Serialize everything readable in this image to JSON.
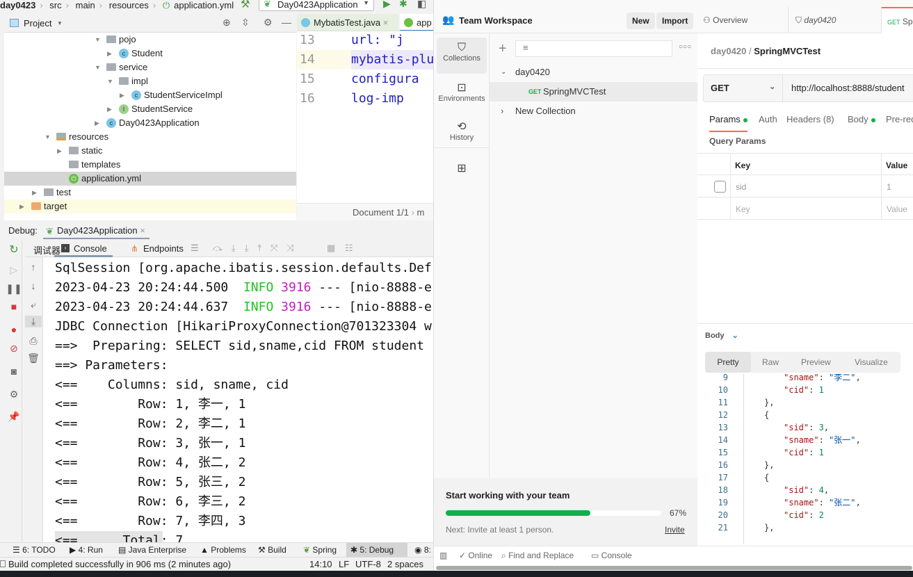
{
  "ide": {
    "breadcrumb": [
      "day0423",
      "src",
      "main",
      "resources",
      "application.yml"
    ],
    "run_config": "Day0423Application",
    "project_panel": {
      "title": "Project"
    },
    "tree": [
      {
        "label": "pojo",
        "type": "package",
        "expanded": true
      },
      {
        "label": "Student",
        "type": "class"
      },
      {
        "label": "service",
        "type": "package",
        "expanded": true
      },
      {
        "label": "impl",
        "type": "package",
        "expanded": true
      },
      {
        "label": "StudentServiceImpl",
        "type": "class"
      },
      {
        "label": "StudentService",
        "type": "interface"
      },
      {
        "label": "Day0423Application",
        "type": "spring-app"
      },
      {
        "label": "resources",
        "type": "resource-folder",
        "expanded": true
      },
      {
        "label": "static",
        "type": "folder"
      },
      {
        "label": "templates",
        "type": "folder"
      },
      {
        "label": "application.yml",
        "type": "yml",
        "selected": true
      },
      {
        "label": "test",
        "type": "folder"
      },
      {
        "label": "target",
        "type": "excluded-folder"
      }
    ],
    "editor": {
      "tabs": [
        {
          "label": "MybatisTest.java"
        },
        {
          "label": "app",
          "active": true
        }
      ],
      "lines": [
        {
          "num": "13",
          "code": "  url: \"j"
        },
        {
          "num": "14",
          "code": "mybatis-plu"
        },
        {
          "num": "15",
          "code": " configura"
        },
        {
          "num": "16",
          "code": "  log-imp"
        }
      ],
      "breadcrumb": "Document 1/1",
      "breadcrumb_next": "m"
    },
    "debug": {
      "label": "Debug:",
      "session_tab": "Day0423Application",
      "tabs": [
        "调试器",
        "Console",
        "Endpoints"
      ],
      "active_tab": "Console",
      "console_lines": [
        [
          {
            "t": "SqlSession [org.apache.ibatis.session.defaults.Def"
          }
        ],
        [
          {
            "t": "2023-04-23 20:24:44.500  "
          },
          {
            "t": "INFO",
            "c": "#22c322"
          },
          {
            "t": " "
          },
          {
            "t": "3916",
            "c": "#c21ec2"
          },
          {
            "t": " --- [nio-8888-e"
          }
        ],
        [
          {
            "t": "2023-04-23 20:24:44.637  "
          },
          {
            "t": "INFO",
            "c": "#22c322"
          },
          {
            "t": " "
          },
          {
            "t": "3916",
            "c": "#c21ec2"
          },
          {
            "t": " --- [nio-8888-e"
          }
        ],
        [
          {
            "t": "JDBC Connection [HikariProxyConnection@701323304 w"
          }
        ],
        [
          {
            "t": "==>  Preparing: SELECT sid,sname,cid FROM student"
          }
        ],
        [
          {
            "t": "==> Parameters: "
          }
        ],
        [
          {
            "t": "<==    Columns: sid, sname, cid"
          }
        ],
        [
          {
            "t": "<==        Row: 1, 李一, 1"
          }
        ],
        [
          {
            "t": "<==        Row: 2, 李二, 1"
          }
        ],
        [
          {
            "t": "<==        Row: 3, 张一, 1"
          }
        ],
        [
          {
            "t": "<==        Row: 4, 张二, 2"
          }
        ],
        [
          {
            "t": "<==        Row: 5, 张三, 2"
          }
        ],
        [
          {
            "t": "<==        Row: 6, 李三, 2"
          }
        ],
        [
          {
            "t": "<==        Row: 7, 李四, 3"
          }
        ],
        [
          {
            "t": "<==      Total: 7"
          }
        ]
      ]
    },
    "tool_windows": [
      "6: TODO",
      "4: Run",
      "Java Enterprise",
      "Problems",
      "Build",
      "Spring",
      "5: Debug",
      "8:"
    ],
    "active_tool": "5: Debug",
    "status": {
      "message": "Build completed successfully in 906 ms (2 minutes ago)",
      "position": "14:10",
      "line_sep": "LF",
      "encoding": "UTF-8",
      "indent": "2 spaces"
    }
  },
  "postman": {
    "workspace": "Team Workspace",
    "new_label": "New",
    "import_label": "Import",
    "rail": [
      {
        "label": "Collections",
        "active": true
      },
      {
        "label": "Environments"
      },
      {
        "label": "History"
      }
    ],
    "collections": [
      {
        "name": "day0420",
        "expanded": true,
        "requests": [
          {
            "method": "GET",
            "name": "SpringMVCTest"
          }
        ]
      },
      {
        "name": "New Collection",
        "expanded": false
      }
    ],
    "tabs": [
      {
        "label": "Overview"
      },
      {
        "label": "day0420"
      },
      {
        "method": "GET",
        "label": "Sp",
        "active": true
      }
    ],
    "request": {
      "breadcrumb_parent": "day0420",
      "breadcrumb_name": "SpringMVCTest",
      "method": "GET",
      "url": "http://localhost:8888/student",
      "tabs": [
        "Params",
        "Auth",
        "Headers (8)",
        "Body",
        "Pre-req"
      ],
      "active_tab": "Params",
      "query_title": "Query Params",
      "columns": [
        "Key",
        "Value"
      ],
      "params": [
        {
          "key": "sid",
          "value": "1",
          "checked": false
        }
      ],
      "key_placeholder": "Key",
      "value_placeholder": "Value"
    },
    "response": {
      "label": "Body",
      "views": [
        "Pretty",
        "Raw",
        "Preview",
        "Visualize"
      ],
      "active_view": "Pretty",
      "lines": [
        {
          "n": "9",
          "i": 2,
          "seg": [
            [
              "k",
              "\"sname\""
            ],
            [
              "p",
              ": "
            ],
            [
              "s",
              "\"李二\""
            ],
            [
              "p",
              ","
            ]
          ]
        },
        {
          "n": "10",
          "i": 2,
          "seg": [
            [
              "k",
              "\"cid\""
            ],
            [
              "p",
              ": "
            ],
            [
              "n",
              "1"
            ]
          ]
        },
        {
          "n": "11",
          "i": 1,
          "seg": [
            [
              "p",
              "},"
            ]
          ]
        },
        {
          "n": "12",
          "i": 1,
          "seg": [
            [
              "p",
              "{"
            ]
          ]
        },
        {
          "n": "13",
          "i": 2,
          "seg": [
            [
              "k",
              "\"sid\""
            ],
            [
              "p",
              ": "
            ],
            [
              "n",
              "3"
            ],
            [
              "p",
              ","
            ]
          ]
        },
        {
          "n": "14",
          "i": 2,
          "seg": [
            [
              "k",
              "\"sname\""
            ],
            [
              "p",
              ": "
            ],
            [
              "s",
              "\"张一\""
            ],
            [
              "p",
              ","
            ]
          ]
        },
        {
          "n": "15",
          "i": 2,
          "seg": [
            [
              "k",
              "\"cid\""
            ],
            [
              "p",
              ": "
            ],
            [
              "n",
              "1"
            ]
          ]
        },
        {
          "n": "16",
          "i": 1,
          "seg": [
            [
              "p",
              "},"
            ]
          ]
        },
        {
          "n": "17",
          "i": 1,
          "seg": [
            [
              "p",
              "{"
            ]
          ]
        },
        {
          "n": "18",
          "i": 2,
          "seg": [
            [
              "k",
              "\"sid\""
            ],
            [
              "p",
              ": "
            ],
            [
              "n",
              "4"
            ],
            [
              "p",
              ","
            ]
          ]
        },
        {
          "n": "19",
          "i": 2,
          "seg": [
            [
              "k",
              "\"sname\""
            ],
            [
              "p",
              ": "
            ],
            [
              "s",
              "\"张二\""
            ],
            [
              "p",
              ","
            ]
          ]
        },
        {
          "n": "20",
          "i": 2,
          "seg": [
            [
              "k",
              "\"cid\""
            ],
            [
              "p",
              ": "
            ],
            [
              "n",
              "2"
            ]
          ]
        },
        {
          "n": "21",
          "i": 1,
          "seg": [
            [
              "p",
              "},"
            ]
          ]
        }
      ]
    },
    "onboarding": {
      "title": "Start working with your team",
      "progress_percent": 67,
      "progress_label": "67%",
      "next": "Next: Invite at least 1 person.",
      "invite": "Invite"
    },
    "statusbar": [
      "Online",
      "Find and Replace",
      "Console"
    ],
    "colors": {
      "accent": "#ff6c37",
      "get": "#0cb14b",
      "progress": "#0cb14b"
    }
  }
}
